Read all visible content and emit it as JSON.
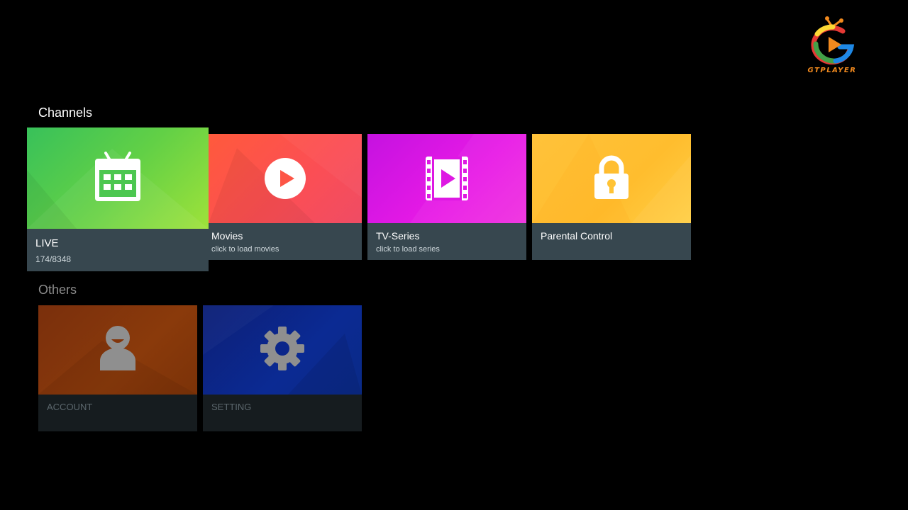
{
  "brand": {
    "name": "GTPLAYER"
  },
  "sections": {
    "channels_title": "Channels",
    "others_title": "Others"
  },
  "cards": {
    "live": {
      "title": "LIVE",
      "subtitle": "174/8348",
      "icon": "tv-calendar-icon",
      "color": "#4cc750"
    },
    "movies": {
      "title": "Movies",
      "subtitle": "click to load movies",
      "icon": "play-circle-icon",
      "color": "#fd5546"
    },
    "series": {
      "title": "TV-Series",
      "subtitle": "click to load series",
      "icon": "film-play-icon",
      "color": "#de18e3"
    },
    "parental": {
      "title": "Parental Control",
      "icon": "lock-icon",
      "color": "#ffc335"
    },
    "account": {
      "title": "ACCOUNT",
      "icon": "user-icon",
      "color": "#82350b"
    },
    "setting": {
      "title": "SETTING",
      "icon": "gear-icon",
      "color": "#0b268a"
    }
  }
}
